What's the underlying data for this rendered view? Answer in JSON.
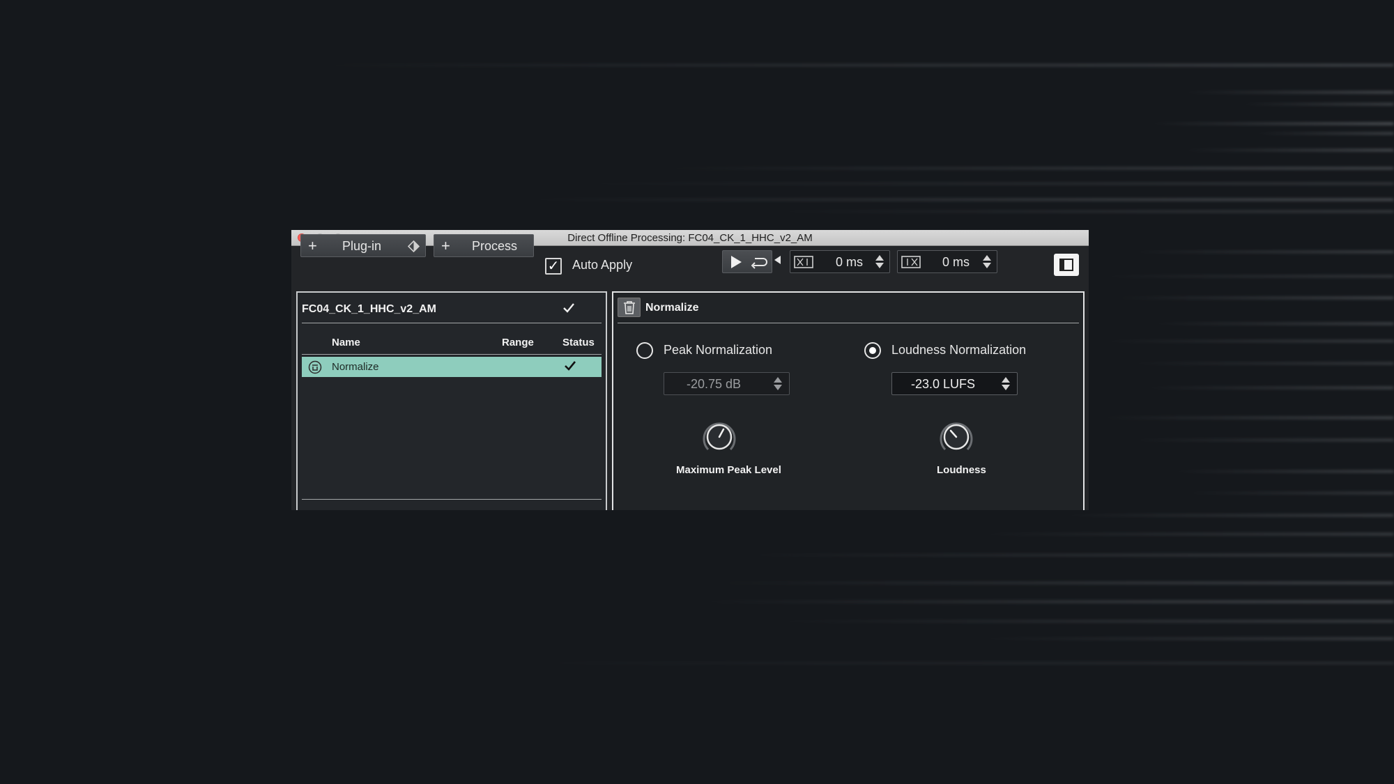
{
  "window": {
    "title": "Direct Offline Processing: FC04_CK_1_HHC_v2_AM"
  },
  "toolbar": {
    "plugin_label": "Plug-in",
    "process_label": "Process",
    "auto_apply_label": "Auto Apply",
    "auto_apply_checked": true,
    "pre_crossfade_value": "0 ms",
    "post_crossfade_value": "0 ms"
  },
  "clip_panel": {
    "clip_name": "FC04_CK_1_HHC_v2_AM",
    "columns": [
      "Name",
      "Range",
      "Status"
    ],
    "rows": [
      {
        "name": "Normalize",
        "range": "",
        "status_checked": true
      }
    ]
  },
  "process_panel": {
    "title": "Normalize",
    "peak": {
      "label": "Peak Normalization",
      "selected": false,
      "value": "-20.75 dB",
      "knob_label": "Maximum Peak Level"
    },
    "loudness": {
      "label": "Loudness Normalization",
      "selected": true,
      "value": "-23.0 LUFS",
      "knob_label": "Loudness"
    }
  },
  "colors": {
    "selection": "#8ecdbd",
    "close_button": "#fc605b"
  },
  "icons": {
    "plugin_extra": "bypass-diamond-icon",
    "play": "play-icon",
    "loop": "loop-icon",
    "pre_crossfade": "pre-crossfade-icon",
    "post_crossfade": "post-crossfade-icon",
    "panel_toggle": "panel-toggle-icon",
    "trash": "trash-icon",
    "row_delete": "row-delete-icon"
  }
}
